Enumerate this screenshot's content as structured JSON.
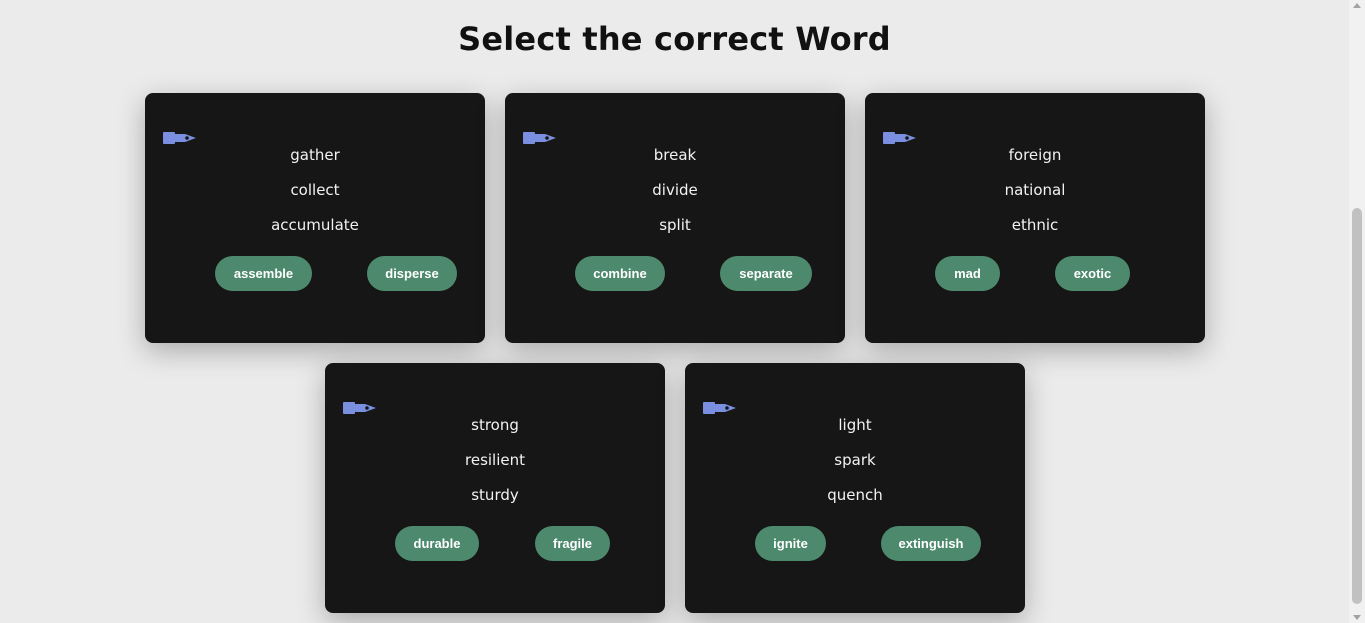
{
  "page": {
    "title": "Select the correct Word"
  },
  "colors": {
    "background": "#ebebeb",
    "card": "#161616",
    "button": "#4d8a6d",
    "icon": "#7b8fe0"
  },
  "cards": [
    {
      "icon": "pen-nib-icon",
      "words": [
        "gather",
        "collect",
        "accumulate"
      ],
      "options": [
        "assemble",
        "disperse"
      ]
    },
    {
      "icon": "pen-nib-icon",
      "words": [
        "break",
        "divide",
        "split"
      ],
      "options": [
        "combine",
        "separate"
      ]
    },
    {
      "icon": "pen-nib-icon",
      "words": [
        "foreign",
        "national",
        "ethnic"
      ],
      "options": [
        "mad",
        "exotic"
      ]
    },
    {
      "icon": "pen-nib-icon",
      "words": [
        "strong",
        "resilient",
        "sturdy"
      ],
      "options": [
        "durable",
        "fragile"
      ]
    },
    {
      "icon": "pen-nib-icon",
      "words": [
        "light",
        "spark",
        "quench"
      ],
      "options": [
        "ignite",
        "extinguish"
      ]
    }
  ]
}
